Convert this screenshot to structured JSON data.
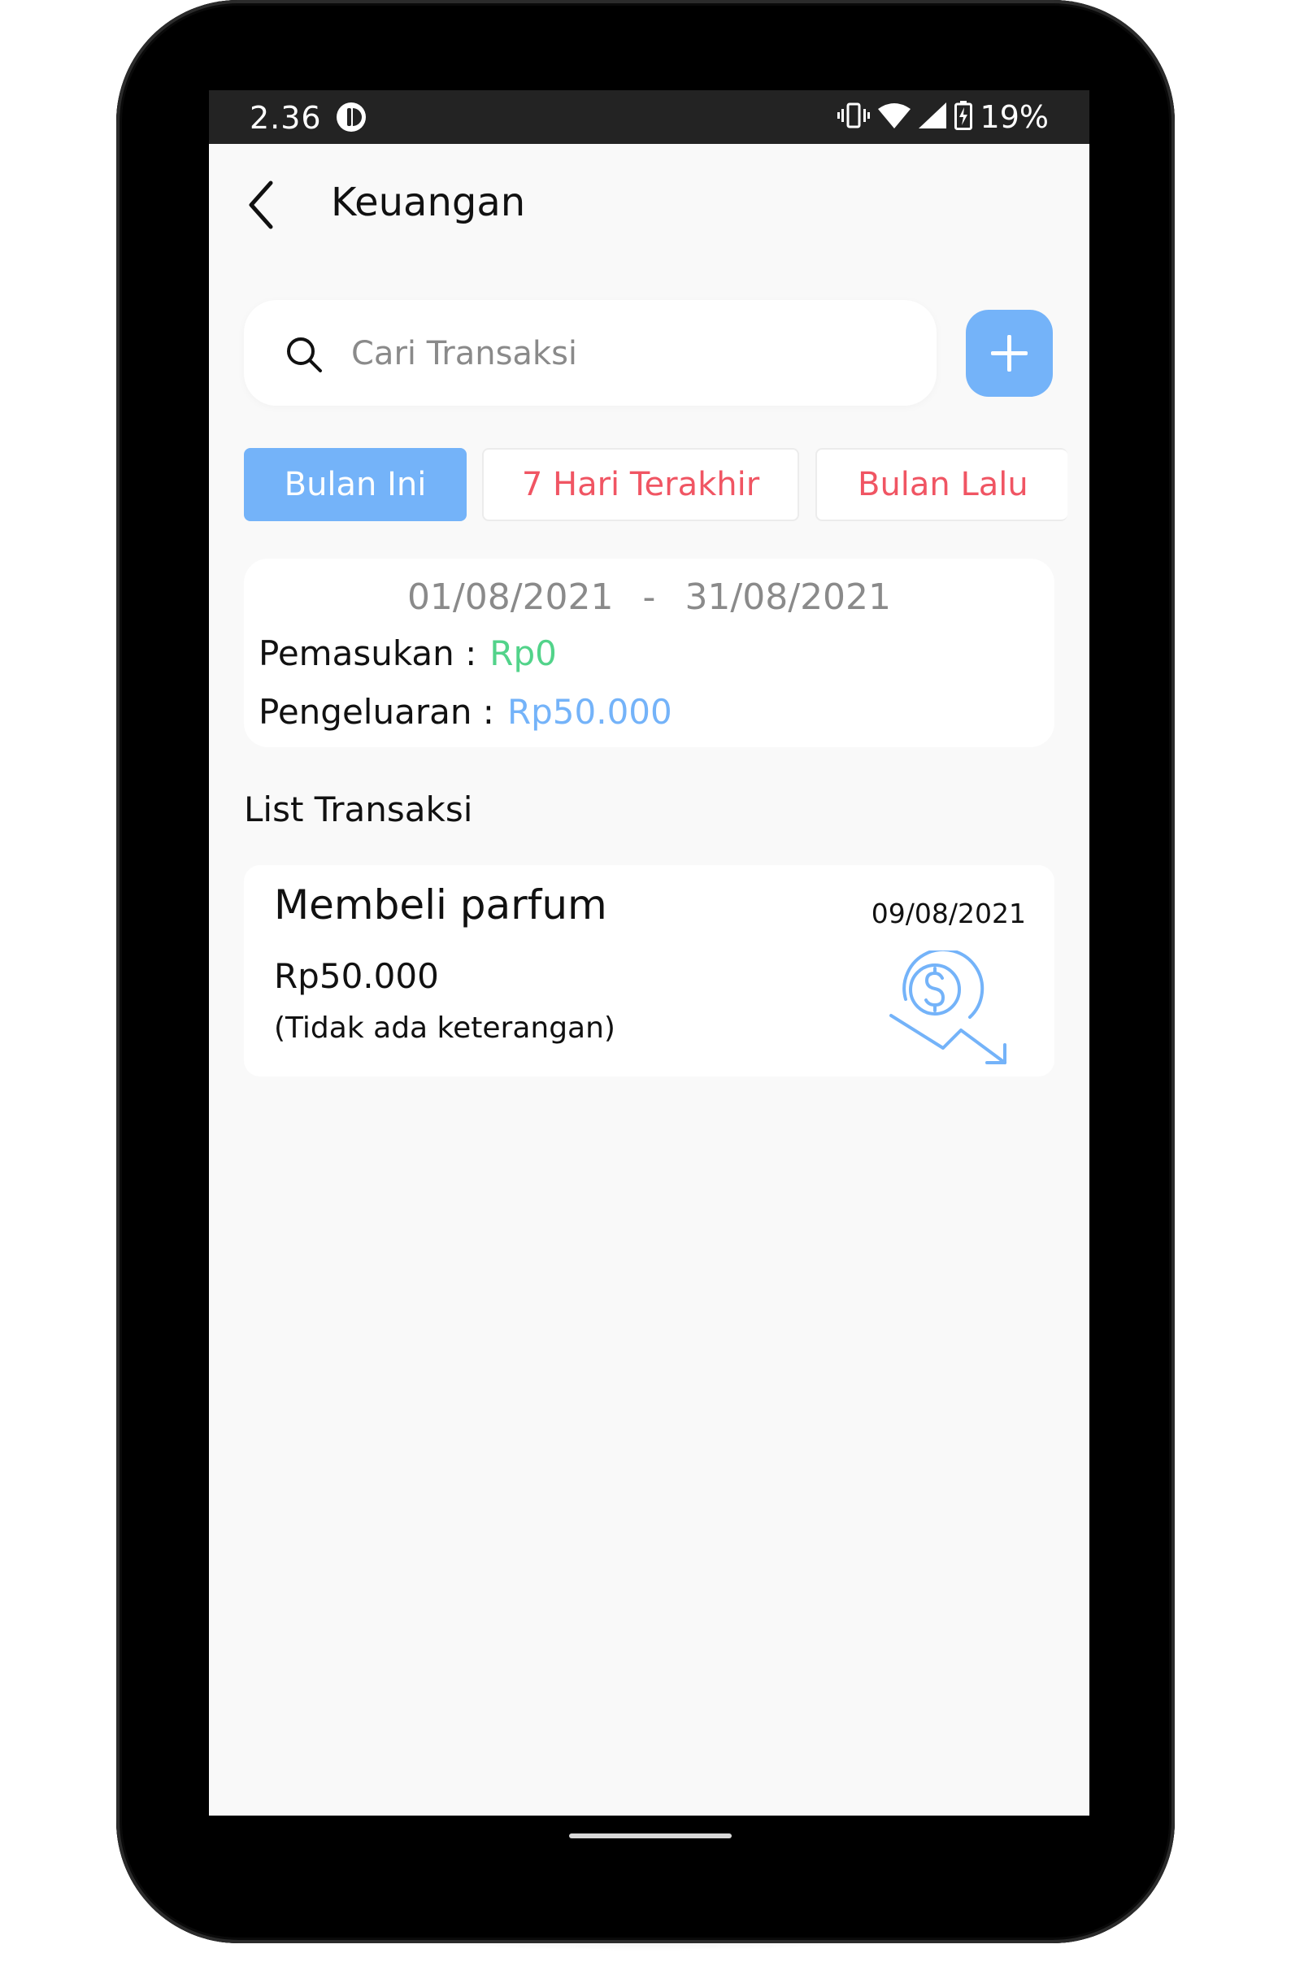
{
  "status_bar": {
    "time": "2.36",
    "battery_percent": "19%"
  },
  "app_bar": {
    "title": "Keuangan"
  },
  "search": {
    "placeholder": "Cari Transaksi",
    "value": ""
  },
  "filters": {
    "tabs": [
      {
        "label": "Bulan Ini",
        "active": true
      },
      {
        "label": "7 Hari Terakhir",
        "active": false
      },
      {
        "label": "Bulan Lalu",
        "active": false
      }
    ]
  },
  "summary": {
    "start_date": "01/08/2021",
    "separator": "-",
    "end_date": "31/08/2021",
    "income_label": "Pemasukan :",
    "income_value": "Rp0",
    "expense_label": "Pengeluaran :",
    "expense_value": "Rp50.000"
  },
  "transactions": {
    "title": "List Transaksi",
    "items": [
      {
        "name": "Membeli parfum",
        "date": "09/08/2021",
        "amount": "Rp50.000",
        "description": "(Tidak ada keterangan)",
        "type_icon": "expense-money-down-icon"
      }
    ]
  },
  "icons": {
    "back": "arrow-back-icon",
    "search": "search-icon",
    "add": "plus-icon",
    "vibrate": "vibrate-icon",
    "wifi": "wifi-icon",
    "signal": "signal-icon",
    "battery": "battery-charging-icon",
    "notification": "notification-app-icon"
  },
  "colors": {
    "accent_blue": "#74b3f9",
    "income_green": "#52d38a",
    "filter_red": "#f05563",
    "status_bar": "#232323",
    "screen_bg": "#f9f9f9"
  }
}
